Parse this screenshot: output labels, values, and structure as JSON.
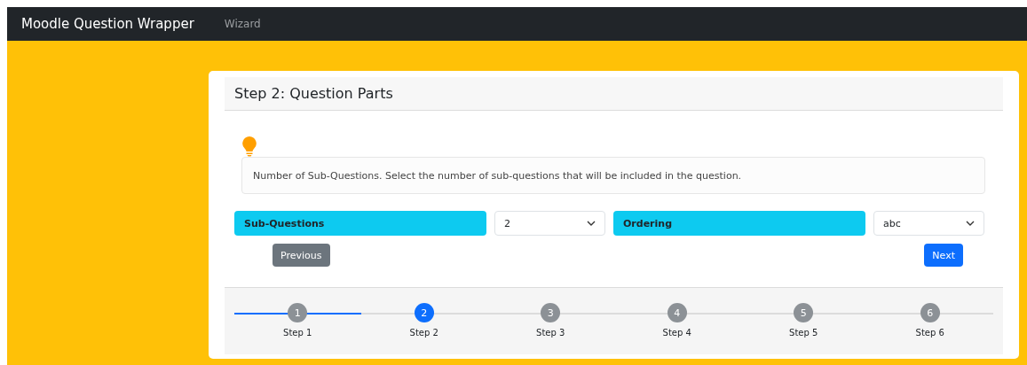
{
  "navbar": {
    "brand": "Moodle Question Wrapper",
    "links": [
      {
        "label": "Wizard",
        "selected": false
      }
    ]
  },
  "card": {
    "title": "Step 2: Question Parts",
    "hint": "Number of Sub-Questions. Select the number of sub-questions that will be included in the question.",
    "fields": [
      {
        "label": "Sub-Questions",
        "value": "2"
      },
      {
        "label": "Ordering",
        "value": "abc"
      }
    ],
    "buttons": [
      {
        "label": "Previous",
        "kind": "secondary"
      },
      {
        "label": "Next",
        "kind": "primary"
      }
    ],
    "steps": [
      {
        "number": "1",
        "label": "Step 1",
        "selected": false,
        "completed": true
      },
      {
        "number": "2",
        "label": "Step 2",
        "selected": true,
        "completed": false
      },
      {
        "number": "3",
        "label": "Step 3",
        "selected": false,
        "completed": false
      },
      {
        "number": "4",
        "label": "Step 4",
        "selected": false,
        "completed": false
      },
      {
        "number": "5",
        "label": "Step 5",
        "selected": false,
        "completed": false
      },
      {
        "number": "6",
        "label": "Step 6",
        "selected": false,
        "completed": false
      }
    ]
  }
}
